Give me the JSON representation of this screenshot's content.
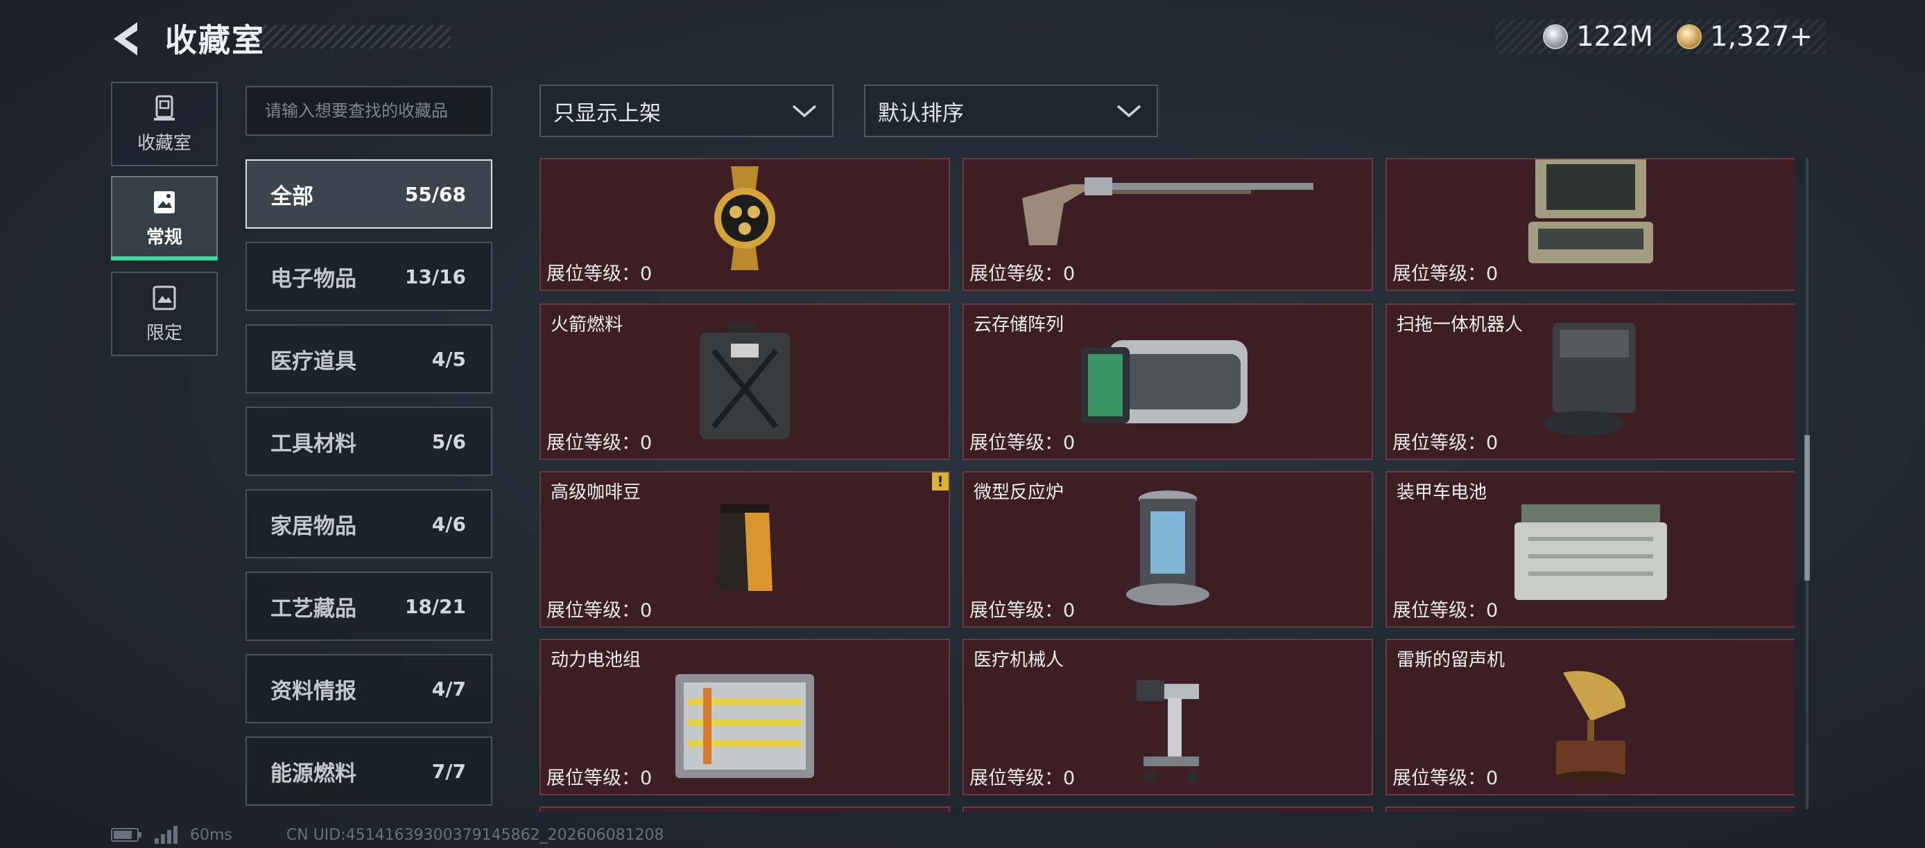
{
  "header": {
    "title": "收藏室"
  },
  "currencies": [
    {
      "icon": "silver-coin-icon",
      "value": "122M"
    },
    {
      "icon": "gold-coin-icon",
      "value": "1,327+"
    }
  ],
  "nav": [
    {
      "label": "收藏室",
      "icon": "collection-room-icon"
    },
    {
      "label": "常规",
      "icon": "regular-items-icon",
      "active": true
    },
    {
      "label": "限定",
      "icon": "limited-items-icon"
    }
  ],
  "search": {
    "placeholder": "请输入想要查找的收藏品"
  },
  "categories": [
    {
      "name": "全部",
      "count": "55/68",
      "active": true
    },
    {
      "name": "电子物品",
      "count": "13/16"
    },
    {
      "name": "医疗道具",
      "count": "4/5"
    },
    {
      "name": "工具材料",
      "count": "5/6"
    },
    {
      "name": "家居物品",
      "count": "4/6"
    },
    {
      "name": "工艺藏品",
      "count": "18/21"
    },
    {
      "name": "资料情报",
      "count": "4/7"
    },
    {
      "name": "能源燃料",
      "count": "7/7"
    }
  ],
  "filters": {
    "listing": {
      "value": "只显示上架"
    },
    "sort": {
      "value": "默认排序"
    }
  },
  "items": [
    {
      "name": "",
      "level": "展位等级：0",
      "icon": "gold-watch-icon"
    },
    {
      "name": "",
      "level": "展位等级：0",
      "icon": "flintlock-rifle-icon"
    },
    {
      "name": "",
      "level": "展位等级：0",
      "icon": "rugged-terminal-icon"
    },
    {
      "name": "火箭燃料",
      "level": "展位等级：0",
      "icon": "fuel-jerrycan-icon"
    },
    {
      "name": "云存储阵列",
      "level": "展位等级：0",
      "icon": "storage-array-icon"
    },
    {
      "name": "扫拖一体机器人",
      "level": "展位等级：0",
      "icon": "mop-robot-icon"
    },
    {
      "name": "高级咖啡豆",
      "level": "展位等级：0",
      "icon": "coffee-bag-icon",
      "warning": "!"
    },
    {
      "name": "微型反应炉",
      "level": "展位等级：0",
      "icon": "micro-reactor-icon"
    },
    {
      "name": "装甲车电池",
      "level": "展位等级：0",
      "icon": "armored-battery-icon"
    },
    {
      "name": "动力电池组",
      "level": "展位等级：0",
      "icon": "battery-pack-icon"
    },
    {
      "name": "医疗机械人",
      "level": "展位等级：0",
      "icon": "medical-robot-icon"
    },
    {
      "name": "雷斯的留声机",
      "level": "展位等级：0",
      "icon": "gramophone-icon"
    }
  ],
  "footer": {
    "ping": "60ms",
    "uid": "CN UID:45141639300379145862_202606081208"
  }
}
